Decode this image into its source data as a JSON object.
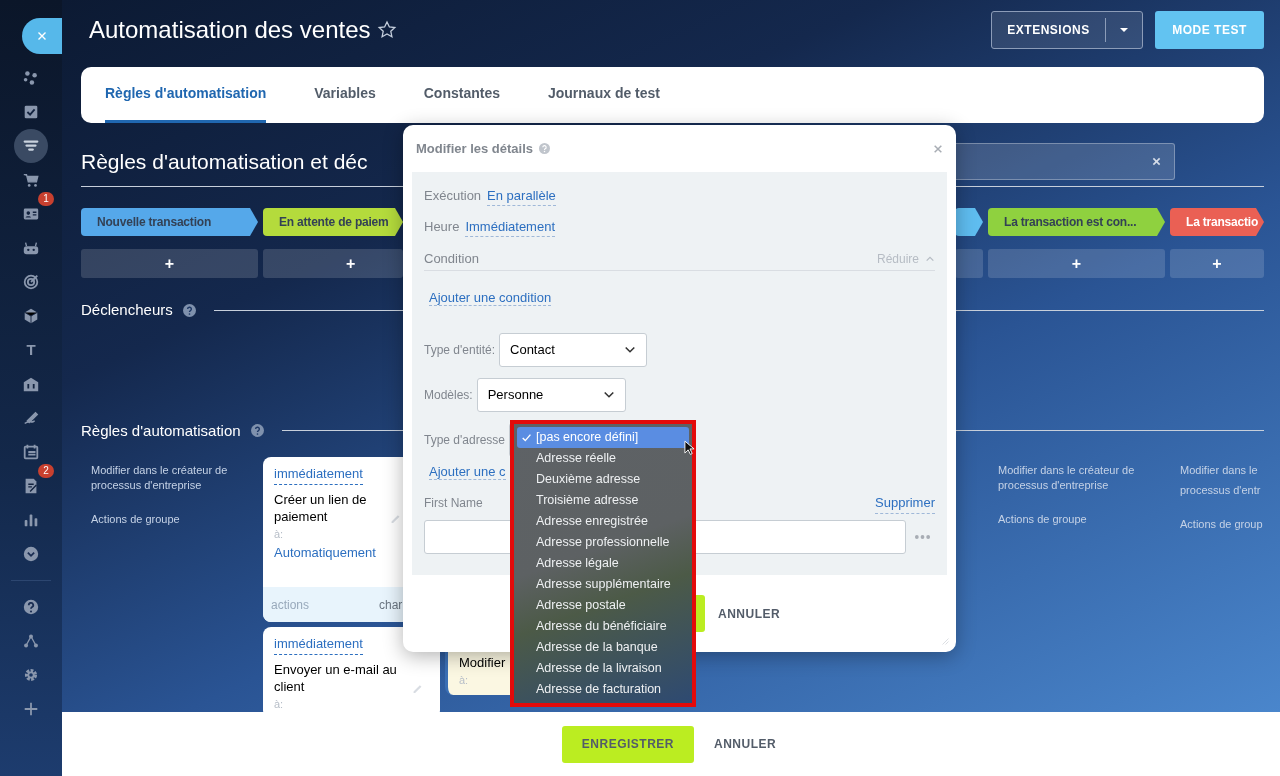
{
  "sidebar": {
    "items": [
      {
        "kind": "circles",
        "selected": false
      },
      {
        "kind": "checkbox",
        "selected": false
      },
      {
        "kind": "funnel",
        "selected": true
      },
      {
        "kind": "cart",
        "selected": false
      },
      {
        "kind": "contact-card",
        "selected": false,
        "badge": "1"
      },
      {
        "kind": "robot",
        "selected": false
      },
      {
        "kind": "target",
        "selected": false
      },
      {
        "kind": "cube",
        "selected": false
      },
      {
        "kind": "letter",
        "text": "T",
        "selected": false
      },
      {
        "kind": "bank",
        "selected": false
      },
      {
        "kind": "signature",
        "selected": false
      },
      {
        "kind": "calendar",
        "selected": false
      },
      {
        "kind": "document",
        "selected": false,
        "badge": "2"
      },
      {
        "kind": "chart",
        "selected": false
      },
      {
        "kind": "chevron",
        "selected": false
      },
      {
        "kind": "divider"
      },
      {
        "kind": "help",
        "selected": false
      },
      {
        "kind": "sitemap",
        "selected": false
      },
      {
        "kind": "gear",
        "selected": false
      },
      {
        "kind": "plus",
        "selected": false
      }
    ]
  },
  "header": {
    "title": "Automatisation des ventes",
    "starred": false,
    "extensions": "EXTENSIONS",
    "test_mode": "MODE TEST"
  },
  "tabs": [
    {
      "label": "Règles d'automatisation",
      "selected": true
    },
    {
      "label": "Variables",
      "selected": false
    },
    {
      "label": "Constantes",
      "selected": false
    },
    {
      "label": "Journaux de test",
      "selected": false
    }
  ],
  "heading": "Règles d'automatisation et déc",
  "stages": [
    {
      "label": "Nouvelle transaction",
      "color": "#55a8ea",
      "add": "+"
    },
    {
      "label": "En attente de paiem",
      "color": "#b4db3c",
      "add": "+"
    },
    {
      "color": "#5fbdf0"
    },
    {
      "label": "La transaction est con...",
      "color": "#8fd13f",
      "add": "+"
    },
    {
      "label": "La transactio",
      "color": "#ea6054",
      "add": "+"
    }
  ],
  "sections": {
    "triggers": "Déclencheurs",
    "rules": "Règles d'automatisation"
  },
  "rule_columns": [
    {
      "kind": "links",
      "links": [
        "Modifier dans le créateur de processus d'entreprise",
        "Actions de groupe"
      ]
    },
    {
      "kind": "cards",
      "cards": [
        {
          "delay": "immédiatement",
          "title": "Créer un lien de paiement",
          "to_label": "à:",
          "target": "Automatiquement",
          "footer": [
            "actions",
            "char"
          ],
          "highlighted": false
        },
        {
          "delay": "immédiatement",
          "title": "Envoyer un e-mail au client",
          "to_label": "à:",
          "highlighted": false
        }
      ]
    },
    {
      "kind": "cards",
      "cards": [
        {
          "title": "Modifier",
          "to_label": "à:",
          "highlighted": true
        }
      ]
    },
    {
      "kind": "links",
      "links": [
        "Modifier dans le créateur de processus d'entreprise",
        "Actions de groupe"
      ]
    },
    {
      "kind": "links",
      "links": [
        "Modifier dans le",
        "processus d'entr",
        "Actions de group"
      ]
    }
  ],
  "modal": {
    "title": "Modifier les détails",
    "rows": [
      {
        "label": "Exécution",
        "value": "En parallèle"
      },
      {
        "label": "Heure",
        "value": "Immédiatement"
      }
    ],
    "condition": {
      "label": "Condition",
      "collapse": "Réduire",
      "add": "Ajouter une condition"
    },
    "selects": [
      {
        "label": "Type d'entité:",
        "value": "Contact"
      },
      {
        "label": "Modèles:",
        "value": "Personne"
      },
      {
        "label": "Type d'adresse"
      }
    ],
    "add_field": "Ajouter une c",
    "field": {
      "label": "First Name",
      "action": "Supprimer"
    },
    "cancel": "ANNULER"
  },
  "dropdown": {
    "options": [
      {
        "label": "[pas encore défini]",
        "selected": true
      },
      {
        "label": "Adresse réelle",
        "selected": false
      },
      {
        "label": "Deuxième adresse",
        "selected": false
      },
      {
        "label": "Troisième adresse",
        "selected": false
      },
      {
        "label": "Adresse enregistrée",
        "selected": false
      },
      {
        "label": "Adresse professionnelle",
        "selected": false
      },
      {
        "label": "Adresse légale",
        "selected": false
      },
      {
        "label": "Adresse supplémentaire",
        "selected": false
      },
      {
        "label": "Adresse postale",
        "selected": false
      },
      {
        "label": "Adresse du bénéficiaire",
        "selected": false
      },
      {
        "label": "Adresse de la banque",
        "selected": false
      },
      {
        "label": "Adresse de la livraison",
        "selected": false
      },
      {
        "label": "Adresse de facturation",
        "selected": false
      }
    ]
  },
  "footer": {
    "save": "ENREGISTRER",
    "cancel": "ANNULER"
  }
}
